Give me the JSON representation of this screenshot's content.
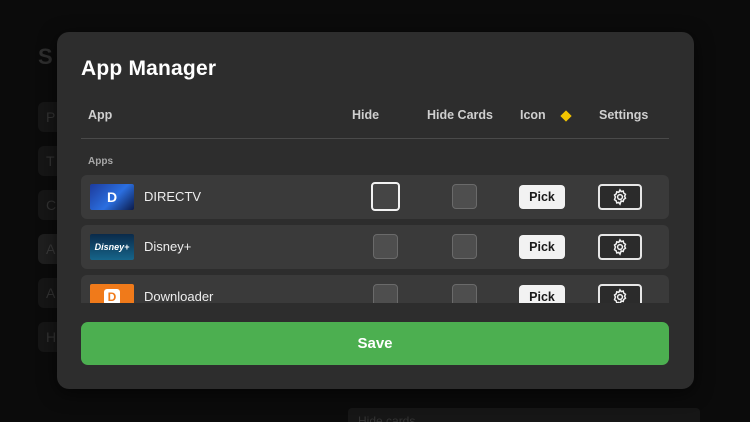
{
  "background": {
    "title": "S",
    "items": [
      "P",
      "T",
      "C",
      "A",
      "A",
      "H"
    ],
    "bottom_text": "Hide cards..."
  },
  "modal": {
    "title": "App Manager",
    "columns": {
      "app": "App",
      "hide": "Hide",
      "hide_cards": "Hide Cards",
      "icon": "Icon",
      "settings": "Settings"
    },
    "section_label": "Apps",
    "apps": [
      {
        "name": "DIRECTV",
        "logo_text": "D",
        "hide": false,
        "hide_cards": false,
        "pick_label": "Pick"
      },
      {
        "name": "Disney+",
        "logo_text": "Disney+",
        "hide": false,
        "hide_cards": false,
        "pick_label": "Pick"
      },
      {
        "name": "Downloader",
        "logo_text": "D",
        "hide": false,
        "hide_cards": false,
        "pick_label": "Pick"
      }
    ],
    "save_label": "Save"
  },
  "colors": {
    "modal_bg": "#2d2d2d",
    "row_bg": "#3a3a3a",
    "save_green": "#4caf50",
    "icon_diamond": "#f2c400",
    "downloader_orange": "#f07a1a"
  },
  "icons": {
    "icon_column_marker": "diamond-icon",
    "settings": "gear-icon"
  }
}
